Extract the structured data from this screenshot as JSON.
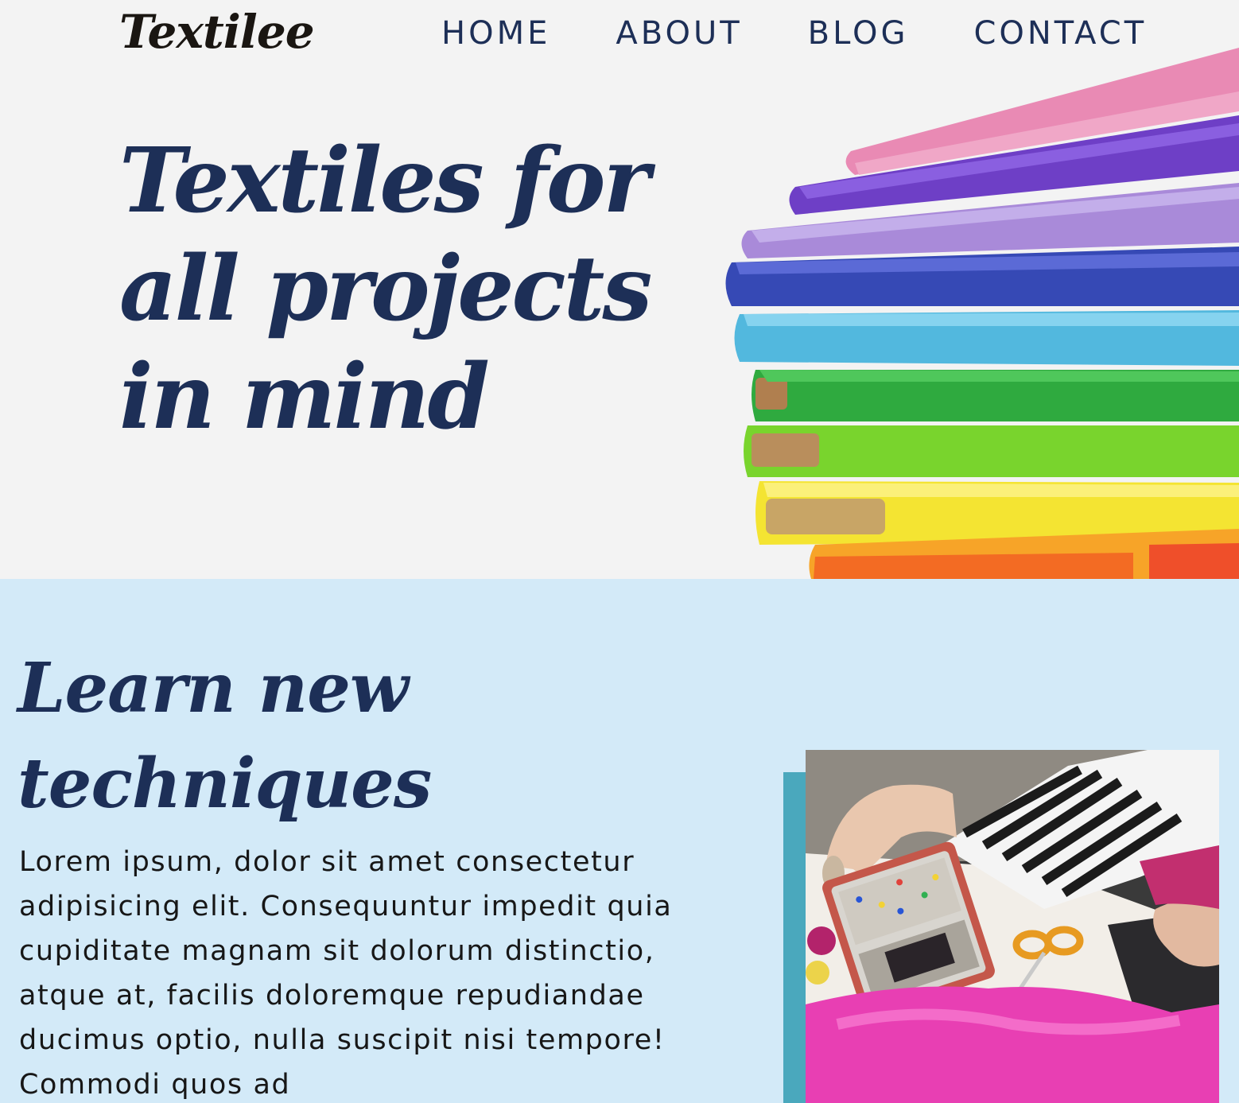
{
  "header": {
    "logo": "Textilee",
    "nav": [
      "HOME",
      "ABOUT",
      "BLOG",
      "CONTACT"
    ]
  },
  "hero": {
    "title": "Textiles for all projects in mind",
    "image_icon": "fabric-rolls-stack-image"
  },
  "learn": {
    "title": "Learn new techniques",
    "body": "Lorem ipsum, dolor sit amet consectetur adipisicing elit. Consequuntur impedit quia cupiditate magnam sit dolorum distinctio, atque at, facilis doloremque repudiandae ducimus optio, nulla suscipit nisi tempore! Commodi quos ad",
    "image_icon": "sewing-pins-image"
  },
  "colors": {
    "hero_bg": "#f3f3f3",
    "section_bg": "#d3eaf8",
    "heading": "#1d2f57",
    "accent": "#4aa8bd"
  }
}
